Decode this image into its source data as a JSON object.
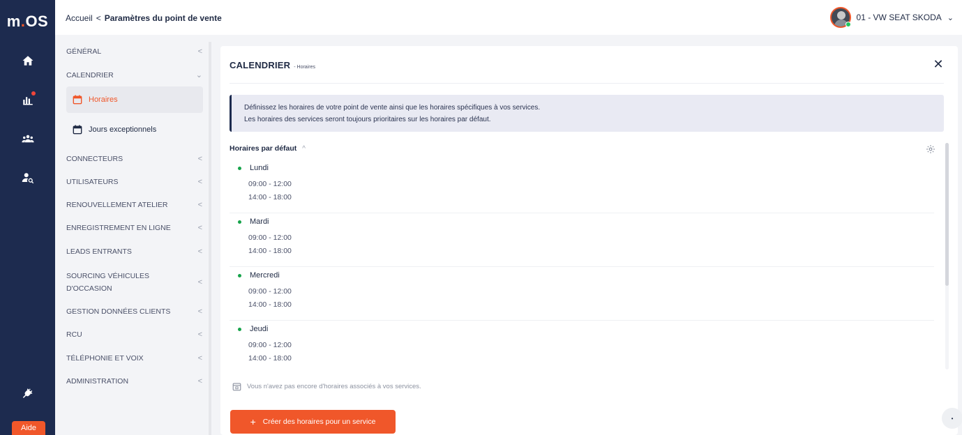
{
  "app": {
    "logo_prefix": "m",
    "logo_dot": ".",
    "logo_suffix": "OS",
    "aide_label": "Aide"
  },
  "breadcrumb": {
    "home": "Accueil",
    "separator": "<",
    "current": "Paramètres du point de vente"
  },
  "account": {
    "label": "01 - VW SEAT SKODA",
    "chevron": "⌄"
  },
  "rail": {
    "icons": [
      "home-icon",
      "chart-icon",
      "team-icon",
      "user-search-icon",
      "plug-icon"
    ],
    "chart_has_notification": true
  },
  "settings_nav": {
    "sections": [
      {
        "label": "GÉNÉRAL",
        "chevron": "<"
      },
      {
        "label": "CALENDRIER",
        "chevron": "⌄"
      },
      {
        "label": "CONNECTEURS",
        "chevron": "<"
      },
      {
        "label": "UTILISATEURS",
        "chevron": "<"
      },
      {
        "label": "RENOUVELLEMENT ATELIER",
        "chevron": "<"
      },
      {
        "label": "ENREGISTREMENT EN LIGNE",
        "chevron": "<"
      },
      {
        "label": "LEADS ENTRANTS",
        "chevron": "<"
      },
      {
        "label": "SOURCING VÉHICULES D'OCCASION",
        "chevron": "<"
      },
      {
        "label": "GESTION DONNÉES CLIENTS",
        "chevron": "<"
      },
      {
        "label": "RCU",
        "chevron": "<"
      },
      {
        "label": "TÉLÉPHONIE ET VOIX",
        "chevron": "<"
      },
      {
        "label": "ADMINISTRATION",
        "chevron": "<"
      }
    ],
    "calendar_items": [
      {
        "label": "Horaires",
        "active": true
      },
      {
        "label": "Jours exceptionnels",
        "active": false
      }
    ]
  },
  "panel": {
    "title": "CALENDRIER",
    "subtitle": "- Horaires",
    "close": "✕",
    "info_line_1": "Définissez les horaires de votre point de vente ainsi que les horaires spécifiques à vos services.",
    "info_line_2": "Les horaires des services seront toujours prioritaires sur les horaires par défaut.",
    "defaults_title": "Horaires par défaut",
    "defaults_chevron": "^",
    "days": [
      {
        "name": "Lundi",
        "slots": [
          "09:00 - 12:00",
          "14:00 - 18:00"
        ]
      },
      {
        "name": "Mardi",
        "slots": [
          "09:00 - 12:00",
          "14:00 - 18:00"
        ]
      },
      {
        "name": "Mercredi",
        "slots": [
          "09:00 - 12:00",
          "14:00 - 18:00"
        ]
      },
      {
        "name": "Jeudi",
        "slots": [
          "09:00 - 12:00",
          "14:00 - 18:00"
        ]
      }
    ],
    "no_service_text": "Vous n'avez pas encore d'horaires associés à vos services.",
    "create_button_plus": "+",
    "create_button_label": "Créer des horaires pour un service"
  },
  "colors": {
    "rail_bg": "#1d2b4f",
    "accent": "#f0572a",
    "status_green": "#16a34a"
  }
}
